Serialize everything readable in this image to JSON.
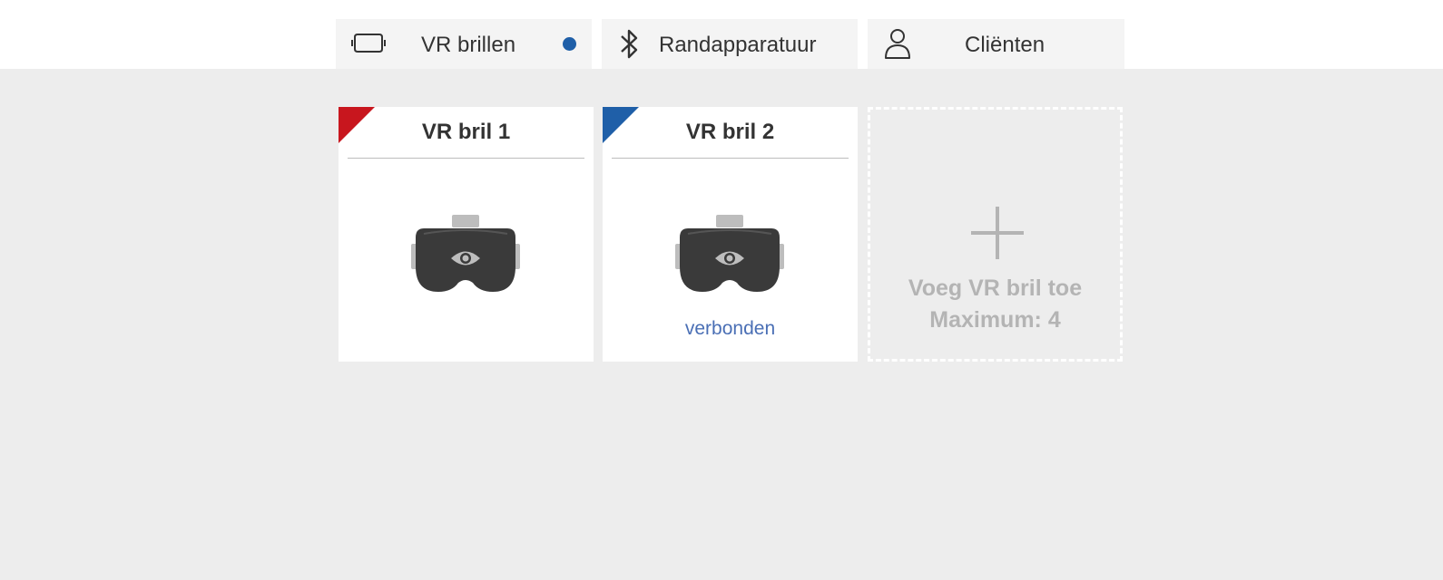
{
  "tabs": {
    "vr": {
      "label": "VR brillen",
      "icon": "vr-headset-outline-icon",
      "status_dot_color": "#1f5fa8"
    },
    "peripherals": {
      "label": "Randapparatuur",
      "icon": "bluetooth-icon"
    },
    "clients": {
      "label": "Cliënten",
      "icon": "person-outline-icon"
    }
  },
  "devices": [
    {
      "name": "VR bril 1",
      "corner_color": "#c8161e",
      "status": ""
    },
    {
      "name": "VR bril 2",
      "corner_color": "#1f5fa8",
      "status": "verbonden",
      "status_color": "#4a6fb5"
    }
  ],
  "add_card": {
    "line1": "Voeg VR bril toe",
    "line2": "Maximum: 4",
    "icon": "plus-icon"
  }
}
